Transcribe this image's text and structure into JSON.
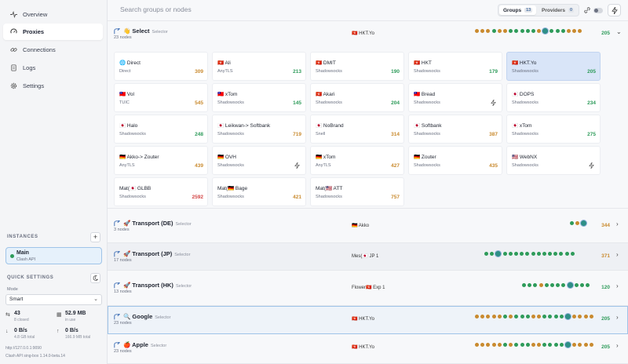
{
  "colors": {
    "green": "#2e9b5a",
    "orange": "#c98a2e",
    "red": "#d34545",
    "gray": "#a6abb6",
    "accent": "#3f6fb5"
  },
  "nav": [
    {
      "label": "Overview",
      "icon": "activity-icon",
      "active": false
    },
    {
      "label": "Proxies",
      "icon": "gauge-icon",
      "active": true
    },
    {
      "label": "Connections",
      "icon": "link-icon",
      "active": false
    },
    {
      "label": "Logs",
      "icon": "document-icon",
      "active": false
    },
    {
      "label": "Settings",
      "icon": "gear-icon",
      "active": false
    }
  ],
  "instances": {
    "title": "INSTANCES",
    "add": "+",
    "main_name": "Main",
    "main_sub": "Clash API"
  },
  "quick": {
    "title": "QUICK SETTINGS",
    "mode_label": "Mode",
    "mode_value": "Smart"
  },
  "stats": {
    "closed_value": "43",
    "closed_label": "8 closed",
    "mem_value": "52.9 MB",
    "mem_label": "in use",
    "down_value": "0 B/s",
    "down_label": "4.8 GB total",
    "up_value": "0 B/s",
    "up_label": "166.9 MB total"
  },
  "footer": {
    "url": "http://127.0.0.1:9090",
    "version": "Clash API sing-box 1.14.0-beta.14"
  },
  "topbar": {
    "search_placeholder": "Search groups or nodes",
    "groups_label": "Groups",
    "groups_count": "13",
    "providers_label": "Providers",
    "providers_count": "0"
  },
  "groups": [
    {
      "name": "👋 Select",
      "type": "Selector",
      "count": "23 nodes",
      "current": "🇭🇰 HKT.Yo",
      "latency": "205"
    },
    {
      "name": "🚀 Transport (DE)",
      "type": "Selector",
      "count": "3 nodes",
      "current": "🇩🇪 Akko",
      "latency": "344"
    },
    {
      "name": "🚀 Transport (JP)",
      "type": "Selector",
      "count": "17 nodes",
      "current": "Mes(🇯🇵 JP 1",
      "latency": "371"
    },
    {
      "name": "🚀 Transport (HK)",
      "type": "Selector",
      "count": "13 nodes",
      "current": "Flower🇭🇰 Exp 1",
      "latency": "120"
    },
    {
      "name": "🔍 Google",
      "type": "Selector",
      "count": "23 nodes",
      "current": "🇭🇰 HKT.Yo",
      "latency": "205"
    },
    {
      "name": "🍎 Apple",
      "type": "Selector",
      "count": "23 nodes",
      "current": "🇭🇰 HKT.Yo",
      "latency": "205"
    }
  ],
  "nodes": [
    {
      "name": "🌐 Direct",
      "type": "Direct",
      "latency": "309",
      "level": "orange"
    },
    {
      "name": "🇭🇰 Ali",
      "type": "AnyTLS",
      "latency": "213",
      "level": "green"
    },
    {
      "name": "🇭🇰 DMIT",
      "type": "Shadowsocks",
      "latency": "190",
      "level": "green"
    },
    {
      "name": "🇭🇰 HKT",
      "type": "Shadowsocks",
      "latency": "179",
      "level": "green"
    },
    {
      "name": "🇭🇰 HKT.Yo",
      "type": "Shadowsocks",
      "latency": "205",
      "level": "green",
      "active": true
    },
    {
      "name": "🇹🇼 Vol",
      "type": "TUIC",
      "latency": "545",
      "level": "orange"
    },
    {
      "name": "🇹🇼 xTom",
      "type": "Shadowsocks",
      "latency": "145",
      "level": "green"
    },
    {
      "name": "🇭🇰 Akari",
      "type": "Shadowsocks",
      "latency": "204",
      "level": "green"
    },
    {
      "name": "🇹🇼 Bread",
      "type": "Shadowsocks",
      "latency": "",
      "level": "none"
    },
    {
      "name": "🇯🇵 DOPS",
      "type": "Shadowsocks",
      "latency": "234",
      "level": "green"
    },
    {
      "name": "🇯🇵 Halo",
      "type": "Shadowsocks",
      "latency": "248",
      "level": "green"
    },
    {
      "name": "🇯🇵 Leikwan-> Softbank",
      "type": "Shadowsocks",
      "latency": "719",
      "level": "orange"
    },
    {
      "name": "🇯🇵 NoBrand",
      "type": "Snell",
      "latency": "314",
      "level": "orange"
    },
    {
      "name": "🇯🇵 Softbank",
      "type": "Shadowsocks",
      "latency": "387",
      "level": "orange"
    },
    {
      "name": "🇯🇵 xTom",
      "type": "Shadowsocks",
      "latency": "275",
      "level": "green"
    },
    {
      "name": "🇩🇪 Akko-> Zouter",
      "type": "AnyTLS",
      "latency": "439",
      "level": "orange"
    },
    {
      "name": "🇩🇪 OVH",
      "type": "Shadowsocks",
      "latency": "",
      "level": "none"
    },
    {
      "name": "🇩🇪 xTom",
      "type": "AnyTLS",
      "latency": "427",
      "level": "orange"
    },
    {
      "name": "🇩🇪 Zouter",
      "type": "Shadowsocks",
      "latency": "435",
      "level": "orange"
    },
    {
      "name": "🇺🇸 WebNX",
      "type": "Shadowsocks",
      "latency": "",
      "level": "none"
    },
    {
      "name": "Mat(🇯🇵 GLBB",
      "type": "Shadowsocks",
      "latency": "2592",
      "level": "red"
    },
    {
      "name": "Mat(🇩🇪 Bage",
      "type": "Shadowsocks",
      "latency": "421",
      "level": "orange"
    },
    {
      "name": "Mat(🇺🇸 ATT",
      "type": "Shadowsocks",
      "latency": "757",
      "level": "orange"
    }
  ],
  "dot_rows": {
    "select": "ooog oogg gggo cggg ooo",
    "de": "go c",
    "jp": "gg cggg gggg gggg gg",
    "hk": "gggo ggg gcgg g",
    "google": "oooo ogog ggoo gggg c oooo",
    "apple": "oooo ogog ggoo gggg c oooo"
  }
}
